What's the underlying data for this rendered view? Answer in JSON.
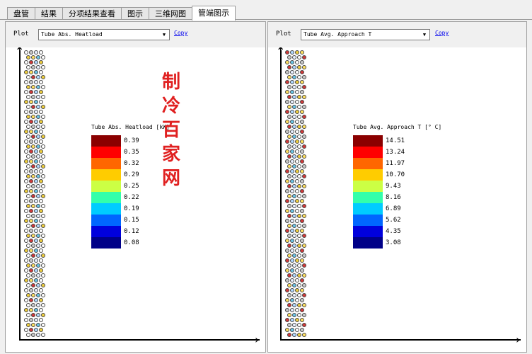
{
  "tabs": [
    {
      "label": "盘管",
      "active": false
    },
    {
      "label": "结果",
      "active": false
    },
    {
      "label": "分项结果查看",
      "active": false
    },
    {
      "label": "图示",
      "active": false
    },
    {
      "label": "三维网图",
      "active": false
    },
    {
      "label": "管端图示",
      "active": true
    }
  ],
  "left_panel": {
    "plot_label": "Plot",
    "selected": "Tube Abs. Heatload",
    "copy_label": "Copy",
    "legend_title": "Tube Abs. Heatload [kW]",
    "legend": [
      {
        "value": "0.39",
        "color": "#8b0000"
      },
      {
        "value": "0.35",
        "color": "#ff0000"
      },
      {
        "value": "0.32",
        "color": "#ff6600"
      },
      {
        "value": "0.29",
        "color": "#ffcc00"
      },
      {
        "value": "0.25",
        "color": "#ccff44"
      },
      {
        "value": "0.22",
        "color": "#33ffaa"
      },
      {
        "value": "0.19",
        "color": "#00ccff"
      },
      {
        "value": "0.15",
        "color": "#0066ff"
      },
      {
        "value": "0.12",
        "color": "#0000dd"
      },
      {
        "value": "0.08",
        "color": "#000088"
      }
    ]
  },
  "right_panel": {
    "plot_label": "Plot",
    "selected": "Tube Avg. Approach T",
    "copy_label": "Copy",
    "legend_title": "Tube Avg. Approach T [° C]",
    "legend": [
      {
        "value": "14.51",
        "color": "#8b0000"
      },
      {
        "value": "13.24",
        "color": "#ff0000"
      },
      {
        "value": "11.97",
        "color": "#ff6600"
      },
      {
        "value": "10.70",
        "color": "#ffcc00"
      },
      {
        "value": "9.43",
        "color": "#ccff44"
      },
      {
        "value": "8.16",
        "color": "#33ffaa"
      },
      {
        "value": "6.89",
        "color": "#00ccff"
      },
      {
        "value": "5.62",
        "color": "#0066ff"
      },
      {
        "value": "4.35",
        "color": "#0000dd"
      },
      {
        "value": "3.08",
        "color": "#000088"
      }
    ]
  },
  "watermark_chars": [
    "制",
    "冷",
    "百",
    "家",
    "网"
  ],
  "tube_palette": [
    "#ffffff",
    "#e8f0ff",
    "#d23a3a",
    "#f0d040",
    "#6ac6e8",
    "#c8c8c8",
    "#ffffff",
    "#b0d8ff",
    "#ffe060"
  ]
}
